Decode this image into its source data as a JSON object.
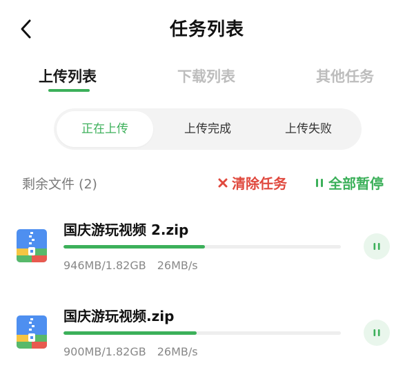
{
  "header": {
    "title": "任务列表",
    "back_icon": "chevron-left-icon"
  },
  "main_tabs": [
    {
      "label": "上传列表",
      "active": true
    },
    {
      "label": "下载列表",
      "active": false
    },
    {
      "label": "其他任务",
      "active": false
    }
  ],
  "sub_tabs": [
    {
      "label": "正在上传",
      "active": true
    },
    {
      "label": "上传完成",
      "active": false
    },
    {
      "label": "上传失败",
      "active": false
    }
  ],
  "summary": {
    "label": "剩余文件 (2)",
    "clear_label": "清除任务",
    "pause_all_label": "全部暂停"
  },
  "colors": {
    "accent": "#3cb05a",
    "danger": "#e0493e"
  },
  "tasks": [
    {
      "name": "国庆游玩视频 2.zip",
      "progress": 0.51,
      "size": "946MB/1.82GB",
      "speed": "26MB/s",
      "icon": "zip-file-icon"
    },
    {
      "name": "国庆游玩视频.zip",
      "progress": 0.48,
      "size": "900MB/1.82GB",
      "speed": "26MB/s",
      "icon": "zip-file-icon"
    }
  ]
}
